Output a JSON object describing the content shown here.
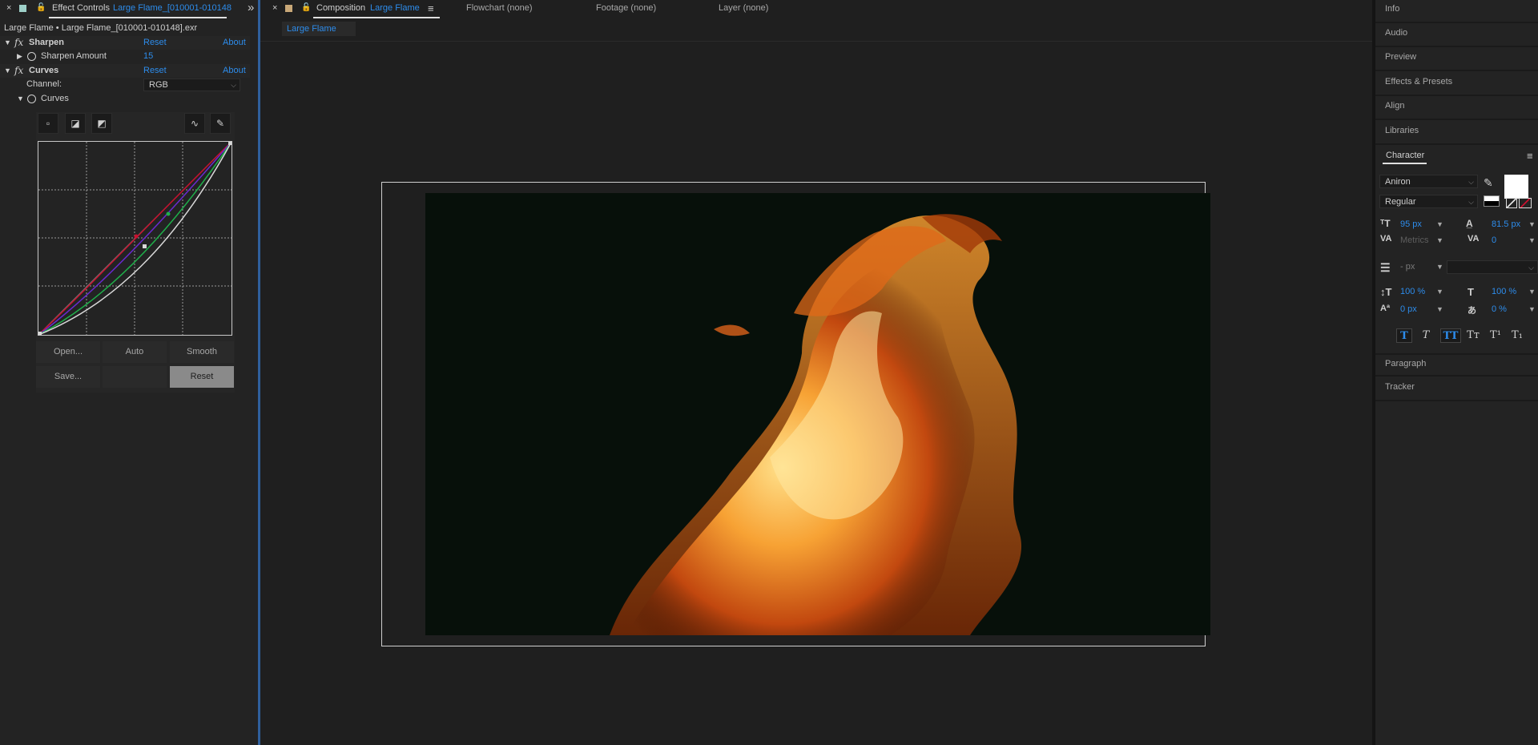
{
  "left_panel": {
    "tab_close": "×",
    "tab_prefix": "Effect Controls",
    "tab_name": "Large Flame_[010001-010148",
    "expand_glyph": "»",
    "layer_path": "Large Flame • Large Flame_[010001-010148].exr",
    "effects": [
      {
        "fx": "fx",
        "name": "Sharpen",
        "reset": "Reset",
        "about": "About"
      },
      {
        "fx": "fx",
        "name": "Curves",
        "reset": "Reset",
        "about": "About"
      }
    ],
    "sharpen_amount": {
      "label": "Sharpen Amount",
      "value": "15"
    },
    "channel": {
      "label": "Channel:",
      "value": "RGB"
    },
    "curves_label": "Curves",
    "curve_buttons": [
      "Open...",
      "Auto",
      "Smooth",
      "Save...",
      "",
      "Reset"
    ]
  },
  "comp_panel": {
    "tab_close": "×",
    "tab_prefix": "Composition",
    "tab_name": "Large Flame",
    "menu_glyph": "≡",
    "other_tabs": [
      "Flowchart (none)",
      "Footage (none)",
      "Layer (none)"
    ],
    "chip": "Large Flame"
  },
  "right_panel": {
    "items_top": [
      "Info",
      "Audio",
      "Preview",
      "Effects & Presets",
      "Align",
      "Libraries"
    ],
    "character_title": "Character",
    "menu_glyph": "≡",
    "font_family": "Aniron",
    "font_style": "Regular",
    "font_size": "95 px",
    "leading": "81.5 px",
    "kerning": "Metrics",
    "tracking": "0",
    "stroke_width": "- px",
    "vert_scale": "100 %",
    "horiz_scale": "100 %",
    "baseline_shift": "0 px",
    "tsume": "0 %",
    "format_buttons": [
      "T",
      "T",
      "TT",
      "Tт",
      "T¹",
      "T₁"
    ],
    "items_bottom": [
      "Paragraph",
      "Tracker"
    ]
  },
  "colors": {
    "accent": "#2d8ceb",
    "panel_bg": "#232323",
    "viewer_bg": "#07100a"
  }
}
